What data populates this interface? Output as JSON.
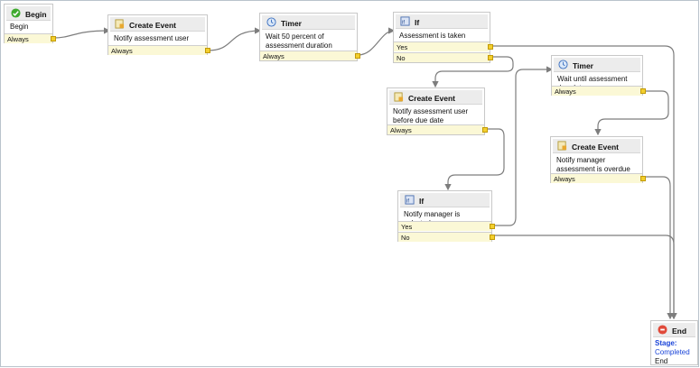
{
  "nodes": {
    "begin": {
      "title": "Begin",
      "desc": "Begin",
      "rows": [
        "Always"
      ]
    },
    "create1": {
      "title": "Create Event",
      "desc": "Notify assessment user",
      "rows": [
        "Always"
      ]
    },
    "timer1": {
      "title": "Timer",
      "desc": "Wait 50 percent of assessment duration",
      "rows": [
        "Always"
      ]
    },
    "if1": {
      "title": "If",
      "desc": "Assessment is taken",
      "rows": [
        "Yes",
        "No"
      ]
    },
    "create2": {
      "title": "Create Event",
      "desc": "Notify assessment user before due date",
      "rows": [
        "Always"
      ]
    },
    "timer2": {
      "title": "Timer",
      "desc": "Wait until assessment due date",
      "rows": [
        "Always"
      ]
    },
    "create3": {
      "title": "Create Event",
      "desc": "Notify manager assessment is overdue",
      "rows": [
        "Always"
      ]
    },
    "if2": {
      "title": "If",
      "desc": "Notify manager is selected",
      "rows": [
        "Yes",
        "No"
      ]
    },
    "end": {
      "title": "End",
      "stage_label": "Stage:",
      "stage_value": "Completed",
      "desc": "End"
    }
  },
  "colors": {
    "wire": "#7d7d7d",
    "port": "#f3cf2e",
    "row": "#fbf8d6",
    "stage": "#1a44d8"
  },
  "icons": {
    "begin": "start-green-icon",
    "event": "event-icon",
    "timer": "clock-icon",
    "if": "condition-icon",
    "end": "stop-red-icon"
  }
}
